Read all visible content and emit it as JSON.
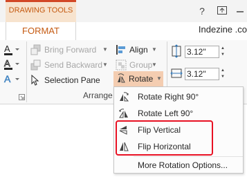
{
  "tabs": {
    "context_label": "DRAWING TOOLS",
    "format_label": "FORMAT",
    "account": "Indezine .co"
  },
  "title_icons": [
    "help-icon",
    "ribbon-display-icon"
  ],
  "ribbon": {
    "bring_forward": "Bring Forward",
    "send_backward": "Send Backward",
    "selection_pane": "Selection Pane",
    "align": "Align",
    "group": "Group",
    "rotate": "Rotate",
    "arrange_group_label": "Arrange",
    "height_value": "3.12\"",
    "width_value": "3.12\""
  },
  "rotate_menu": {
    "items": [
      {
        "label": "Rotate Right 90°",
        "icon": "rotate-right-icon"
      },
      {
        "label": "Rotate Left 90°",
        "icon": "rotate-left-icon"
      },
      {
        "label": "Flip Vertical",
        "icon": "flip-vertical-icon"
      },
      {
        "label": "Flip Horizontal",
        "icon": "flip-horizontal-icon"
      },
      {
        "label": "More Rotation Options...",
        "icon": ""
      }
    ]
  },
  "colors": {
    "accent": "#c55a11",
    "context_tab_bg": "#f7e3ce",
    "rotate_active_bg": "#f4cdb1",
    "highlight_border": "#e81123"
  }
}
